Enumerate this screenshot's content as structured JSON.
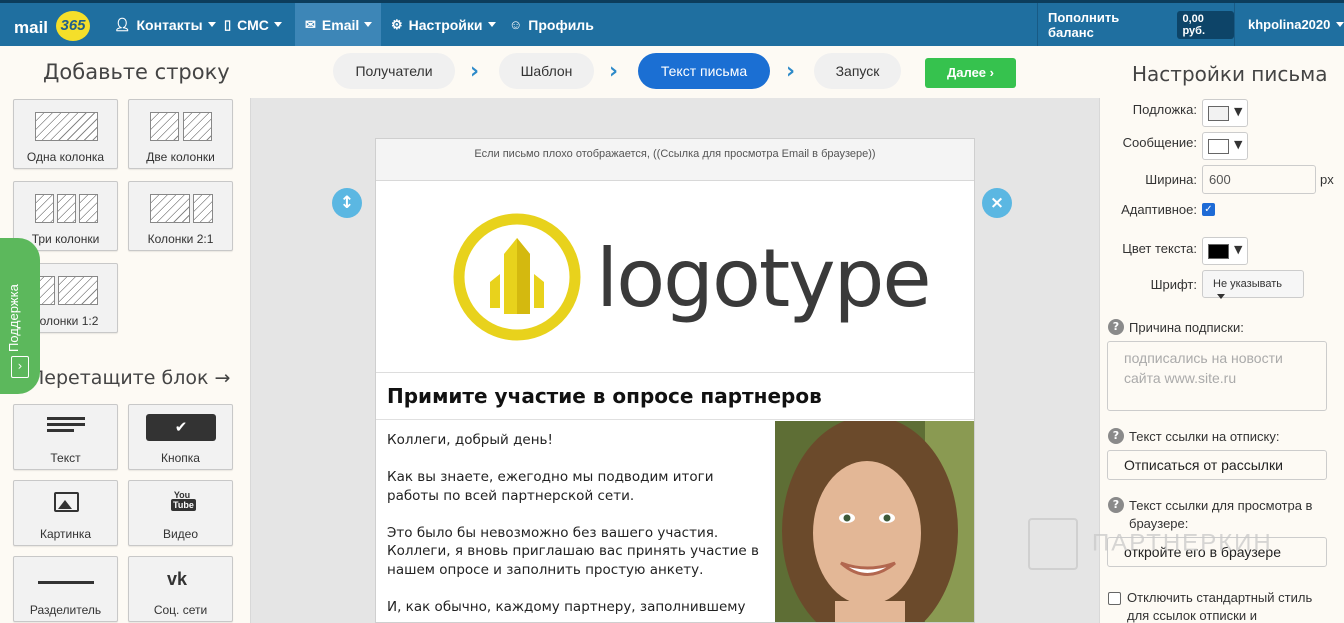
{
  "brand": {
    "mail": "mail",
    "num": "365"
  },
  "topnav": [
    {
      "icon": "person-icon",
      "label": "Контакты"
    },
    {
      "icon": "phone-icon",
      "label": "СМС"
    },
    {
      "icon": "envelope-icon",
      "label": "Email"
    },
    {
      "icon": "gear-icon",
      "label": "Настройки"
    },
    {
      "icon": "user-circle-icon",
      "label": "Профиль"
    }
  ],
  "balance": {
    "label": "Пополнить баланс",
    "amount": "0,00 руб."
  },
  "user": {
    "name": "khpolina2020"
  },
  "left": {
    "add_row_title": "Добавьте строку",
    "rows": [
      "Одна колонка",
      "Две колонки",
      "Три колонки",
      "Колонки 2:1",
      "Колонки 1:2"
    ],
    "drag_title": "Перетащите блок →",
    "blocks": [
      "Текст",
      "Кнопка",
      "Картинка",
      "Видео",
      "Разделитель",
      "Соц. сети"
    ],
    "support": "Поддержка"
  },
  "steps": [
    "Получатели",
    "Шаблон",
    "Текст письма",
    "Запуск"
  ],
  "next_label": "Далее",
  "email": {
    "preheader": "Если письмо плохо отображается, ((Ссылка для просмотра Email в браузере))",
    "logo_text": "logotype",
    "heading": "Примите участие в опросе партнеров",
    "p1": "Коллеги, добрый день!",
    "p2": "Как вы знаете, ежегодно мы подводим итоги работы по всей партнерской сети.",
    "p3": "Это было бы невозможно без вашего участия. Коллеги, я вновь приглашаю вас принять участие в нашем опросе и заполнить простую анкету.",
    "p4": "И, как обычно, каждому партнеру, заполнившему"
  },
  "settings": {
    "title": "Настройки письма",
    "background_label": "Подложка:",
    "message_label": "Сообщение:",
    "width_label": "Ширина:",
    "width_value": "600",
    "width_unit": "px",
    "adaptive_label": "Адаптивное:",
    "text_color_label": "Цвет текста:",
    "font_label": "Шрифт:",
    "font_value": "Не указывать",
    "reason_label": "Причина подписки:",
    "reason_placeholder": "подписались на новости сайта www.site.ru",
    "unsub_label": "Текст ссылки на отписку:",
    "unsub_value": "Отписаться от рассылки",
    "browser_label_1": "Текст ссылки для просмотра в",
    "browser_label_2": "браузере:",
    "browser_value": "откройте его в браузере",
    "disable_style_1": "Отключить стандартный стиль",
    "disable_style_2": "для ссылок отписки и",
    "colors": {
      "background": "#f2f2f2",
      "message": "#ffffff",
      "text": "#000000"
    }
  },
  "watermark": "ПАРТНЕРКИН"
}
